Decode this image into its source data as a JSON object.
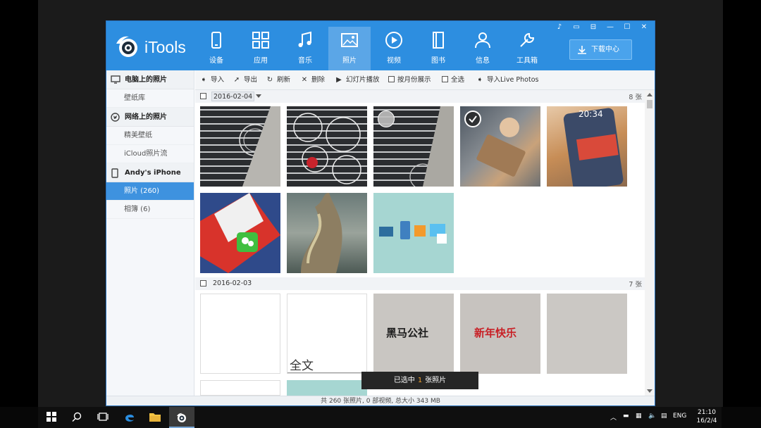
{
  "window": {
    "app_name": "iTools",
    "controls": [
      "♪",
      "▭",
      "⊟",
      "—",
      "☐",
      "✕"
    ]
  },
  "toolbar_top": {
    "items": [
      {
        "label": "设备",
        "icon": "phone-icon"
      },
      {
        "label": "应用",
        "icon": "apps-icon"
      },
      {
        "label": "音乐",
        "icon": "music-icon"
      },
      {
        "label": "照片",
        "icon": "photo-icon",
        "active": true
      },
      {
        "label": "视频",
        "icon": "video-icon"
      },
      {
        "label": "图书",
        "icon": "book-icon"
      },
      {
        "label": "信息",
        "icon": "person-icon"
      },
      {
        "label": "工具箱",
        "icon": "wrench-icon"
      }
    ],
    "download_label": "下载中心"
  },
  "sidebar": {
    "sections": [
      {
        "header": "电脑上的照片",
        "icon": "monitor-icon",
        "items": [
          "壁纸库"
        ]
      },
      {
        "header": "网络上的照片",
        "icon": "globe-icon",
        "items": [
          "精美壁纸",
          "iCloud照片流"
        ]
      },
      {
        "header": "Andy's iPhone",
        "icon": "phone-icon",
        "items": [
          "照片 (260)",
          "相簿 (6)"
        ]
      }
    ],
    "selected": "照片 (260)"
  },
  "actions": {
    "import": "导入",
    "export": "导出",
    "refresh": "刷新",
    "delete": "删除",
    "slideshow": "幻灯片播放",
    "by_month": "按月份展示",
    "select_all": "全选",
    "import_live": "导入Live Photos"
  },
  "groups": [
    {
      "date": "2016-02-04",
      "count": "8 张"
    },
    {
      "date": "2016-02-03",
      "count": "7 张"
    }
  ],
  "photo_texts": {
    "full_text": "全文",
    "heima": "黑马公社",
    "new_year": "新年快乐",
    "lock_time": "20:34"
  },
  "status_text": "共 260 张照片, 0 部视频, 总大小 343 MB",
  "toast": {
    "prefix": "已选中",
    "count": "1",
    "suffix": "张照片"
  },
  "taskbar": {
    "lang": "ENG",
    "time": "21:10",
    "date": "16/2/4"
  }
}
